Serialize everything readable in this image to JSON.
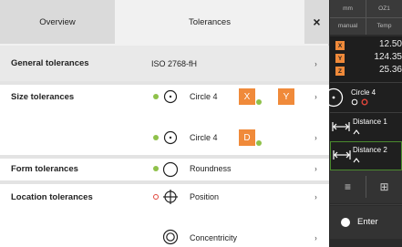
{
  "tabs": {
    "overview": "Overview",
    "tolerances": "Tolerances",
    "close": "×"
  },
  "general": {
    "title": "General tolerances",
    "value": "ISO 2768-fH"
  },
  "size": {
    "title": "Size tolerances",
    "items": [
      {
        "label": "Circle 4",
        "badges": [
          "X",
          "Y"
        ],
        "status": "ok",
        "icon": "circle-center-icon"
      },
      {
        "label": "Circle 4",
        "badges": [
          "D"
        ],
        "status": "ok",
        "icon": "circle-center-icon"
      }
    ]
  },
  "form": {
    "title": "Form tolerances",
    "label": "Roundness",
    "status": "ok",
    "icon": "roundness-icon"
  },
  "location": {
    "title": "Location tolerances",
    "items": [
      {
        "label": "Position",
        "status": "error",
        "icon": "position-icon"
      },
      {
        "label": "Concentricity",
        "icon": "concentricity-icon"
      }
    ]
  },
  "chevron": "›",
  "sidebar": {
    "header": {
      "unit": "mm",
      "slot": "OZ1",
      "mode": "manual",
      "temp": "Temp"
    },
    "coords": [
      {
        "axis": "X",
        "value": "12.50"
      },
      {
        "axis": "Y",
        "value": "124.35"
      },
      {
        "axis": "Z",
        "value": "25.36"
      }
    ],
    "features": [
      {
        "label": "Circle 4",
        "icon": "circle-center-icon"
      },
      {
        "label": "Distance 1",
        "icon": "distance-icon"
      },
      {
        "label": "Distance 2",
        "icon": "distance-icon",
        "highlight": true
      }
    ],
    "tools": {
      "menu": "≡",
      "layout": "⊞"
    },
    "enter_label": "Enter"
  },
  "colors": {
    "accent": "#f08a3a",
    "ok": "#8fc14a",
    "error": "#e0463b",
    "highlight": "#4a8a2e"
  }
}
